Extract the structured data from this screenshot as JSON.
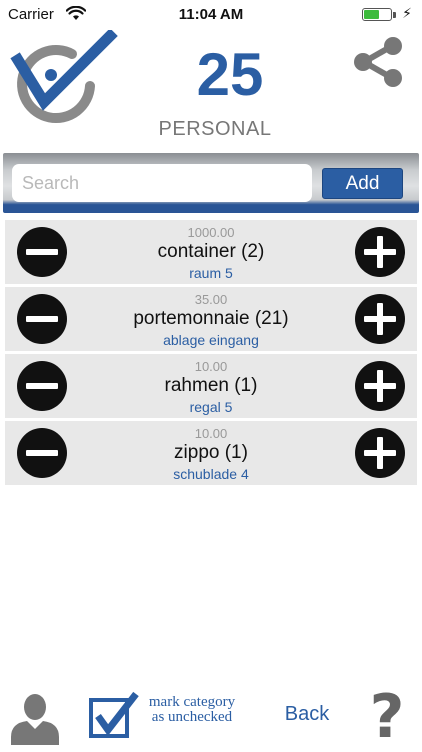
{
  "status_bar": {
    "carrier": "Carrier",
    "time": "11:04 AM",
    "battery_percent": 55
  },
  "header": {
    "count": "25",
    "category": "PERSONAL",
    "logo_icon": "checkmark-logo-icon",
    "share_icon": "share-icon"
  },
  "search": {
    "placeholder": "Search",
    "value": "",
    "add_label": "Add"
  },
  "items": [
    {
      "value": "1000.00",
      "name": "container (2)",
      "location": "raum 5"
    },
    {
      "value": "35.00",
      "name": "portemonnaie (21)",
      "location": "ablage eingang"
    },
    {
      "value": "10.00",
      "name": "rahmen (1)",
      "location": "regal 5"
    },
    {
      "value": "10.00",
      "name": "zippo (1)",
      "location": "schublade 4"
    }
  ],
  "toolbar": {
    "mark_label_line1": "mark category",
    "mark_label_line2": "as unchecked",
    "back_label": "Back",
    "help_glyph": "?"
  },
  "colors": {
    "accent": "#2b5ea3",
    "muted_text": "#777777",
    "row_background": "#e8e8e8"
  }
}
